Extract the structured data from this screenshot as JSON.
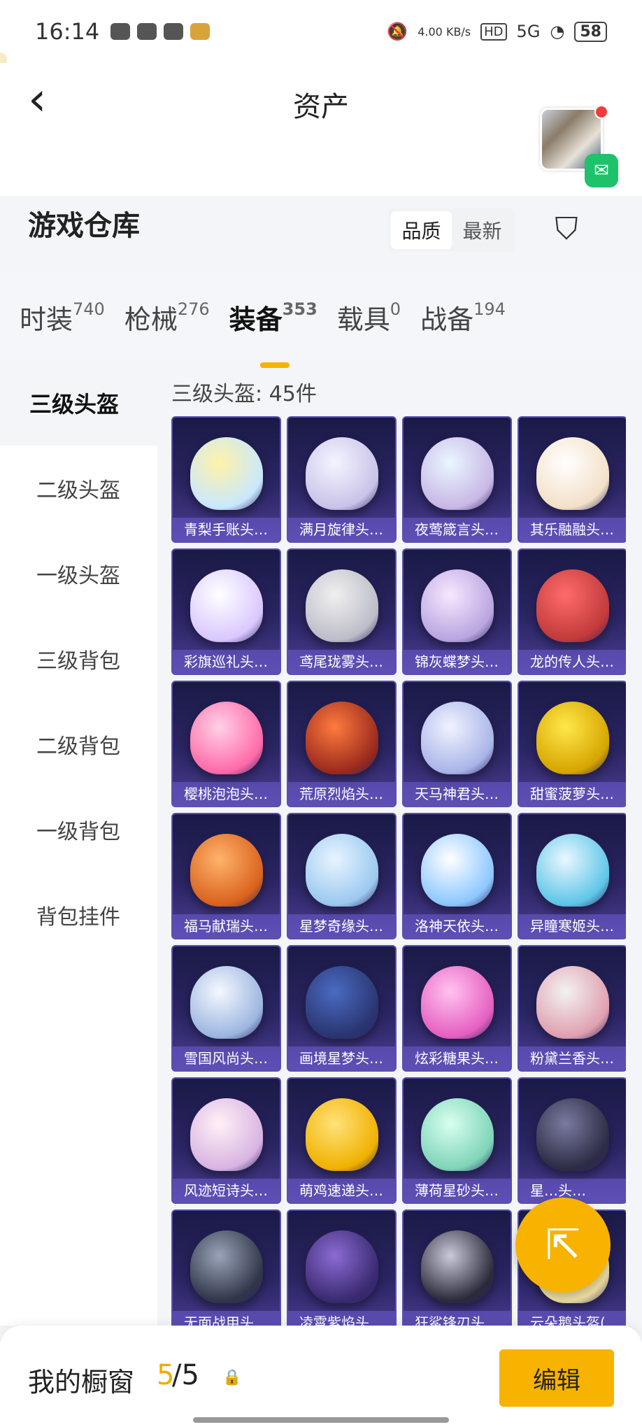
{
  "status": {
    "time": "16:14",
    "speed": "4.00 KB/s",
    "network": "5G",
    "battery": "58"
  },
  "header": {
    "title": "资产"
  },
  "warehouse": {
    "title": "游戏仓库",
    "sort": [
      "品质",
      "最新"
    ]
  },
  "tabs": [
    {
      "label": "时装",
      "count": "740"
    },
    {
      "label": "枪械",
      "count": "276"
    },
    {
      "label": "装备",
      "count": "353"
    },
    {
      "label": "载具",
      "count": "0"
    },
    {
      "label": "战备",
      "count": "194"
    }
  ],
  "sidebar": [
    "三级头盔",
    "二级头盔",
    "一级头盔",
    "三级背包",
    "二级背包",
    "一级背包",
    "背包挂件"
  ],
  "count_label": "三级头盔: 45件",
  "items": [
    "青梨手账头…",
    "满月旋律头…",
    "夜莺箴言头…",
    "其乐融融头…",
    "彩旗巡礼头…",
    "鸢尾珑雾头…",
    "锦灰蝶梦头…",
    "龙的传人头…",
    "樱桃泡泡头…",
    "荒原烈焰头…",
    "天马神君头…",
    "甜蜜菠萝头…",
    "福马献瑞头…",
    "星梦奇缘头…",
    "洛神天依头…",
    "异瞳寒姬头…",
    "雪国风尚头…",
    "画境星梦头…",
    "炫彩糖果头…",
    "粉黛兰香头…",
    "风迹短诗头…",
    "萌鸡速递头…",
    "薄荷星砂头…",
    "星…头…",
    "无面战甲头…",
    "凌霄紫焰头…",
    "狂鲨锋刃头…",
    "云朵鹅头盔(…"
  ],
  "bottom": {
    "label": "我的橱窗",
    "current": "5",
    "total": "/5",
    "edit": "编辑"
  },
  "colors": {
    "accent": "#f7b300",
    "card": "#2b2563"
  }
}
